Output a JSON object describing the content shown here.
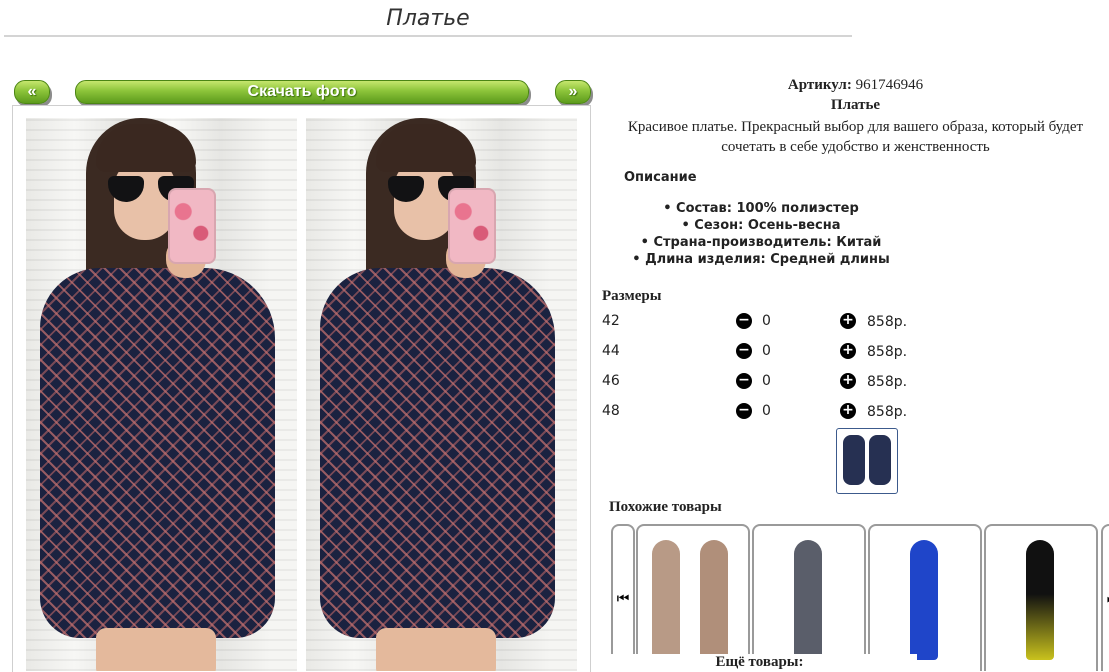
{
  "page": {
    "title": "Платье"
  },
  "gallery": {
    "prev_label": "«",
    "next_label": "»",
    "download_label": "Скачать фото"
  },
  "product": {
    "article_label": "Артикул:",
    "article_value": "961746946",
    "name": "Платье",
    "description": "Красивое платье. Прекрасный выбор для вашего образа, который будет сочетать в себе удобство и женственность"
  },
  "details": {
    "title": "Описание",
    "features": [
      "Состав: 100% полиэстер",
      "Сезон: Осень-весна",
      "Страна-производитель: Китай",
      "Длина изделия: Средней длины"
    ]
  },
  "sizes": {
    "title": "Размеры",
    "rows": [
      {
        "size": "42",
        "qty": "0",
        "price": "858р."
      },
      {
        "size": "44",
        "qty": "0",
        "price": "858р."
      },
      {
        "size": "46",
        "qty": "0",
        "price": "858р."
      },
      {
        "size": "48",
        "qty": "0",
        "price": "858р."
      }
    ],
    "minus_icon": "minus-circle-icon",
    "plus_icon": "plus-circle-icon"
  },
  "similar": {
    "title": "Похожие товары",
    "more_label": "Ещё товары:",
    "prev_icon": "skip-previous-icon",
    "next_icon": "skip-next-icon",
    "cards": [
      {
        "color": "#b89a86"
      },
      {
        "color": "#5a5e6a"
      },
      {
        "color": "#1f45c9"
      },
      {
        "color": "#c9c21d"
      }
    ]
  },
  "colors": {
    "button_green": "#6faa24",
    "text": "#222222",
    "dress_navy": "#1b2240",
    "thumb_border": "#3c5a8c"
  }
}
